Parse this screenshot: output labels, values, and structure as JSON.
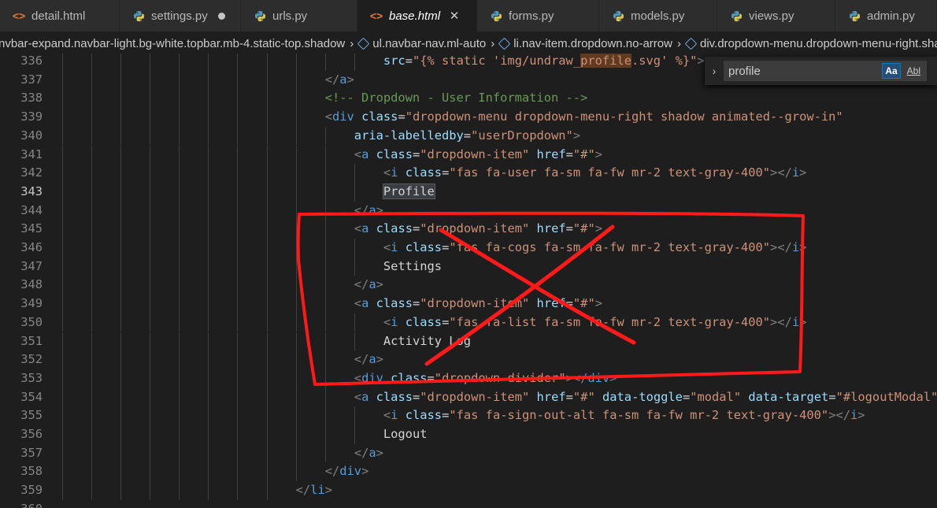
{
  "tabs": [
    {
      "label": "detail.html",
      "icon": "html-icon",
      "active": false,
      "trailing": ""
    },
    {
      "label": "settings.py",
      "icon": "python-icon",
      "active": false,
      "trailing": "modified-dot"
    },
    {
      "label": "urls.py",
      "icon": "python-icon",
      "active": false,
      "trailing": ""
    },
    {
      "label": "base.html",
      "icon": "html-icon",
      "active": true,
      "trailing": "close"
    },
    {
      "label": "forms.py",
      "icon": "python-icon",
      "active": false,
      "trailing": ""
    },
    {
      "label": "models.py",
      "icon": "python-icon",
      "active": false,
      "trailing": ""
    },
    {
      "label": "views.py",
      "icon": "python-icon",
      "active": false,
      "trailing": ""
    },
    {
      "label": "admin.py",
      "icon": "python-icon",
      "active": false,
      "trailing": ""
    }
  ],
  "breadcrumbs": [
    {
      "label": "nvbar-expand.navbar-light.bg-white.topbar.mb-4.static-top.shadow",
      "icon": ""
    },
    {
      "label": "ul.navbar-nav.ml-auto",
      "icon": "element-icon"
    },
    {
      "label": "li.nav-item.dropdown.no-arrow",
      "icon": "element-icon"
    },
    {
      "label": "div.dropdown-menu.dropdown-menu-right.shadow.animated--grow-in",
      "icon": "element-icon"
    }
  ],
  "find_widget": {
    "value": "profile",
    "match_case_label": "Aa",
    "whole_word_label": "Abl"
  },
  "editor": {
    "current_line": "343",
    "lines": [
      {
        "num": "336",
        "indent": 11,
        "tokens": [
          [
            "attr",
            "src"
          ],
          [
            "txt",
            "="
          ],
          [
            "str",
            "\"{% static 'img/undraw_"
          ],
          [
            "strfind",
            "profile"
          ],
          [
            "str",
            ".svg' %}\""
          ],
          [
            "br",
            ">"
          ]
        ]
      },
      {
        "num": "337",
        "indent": 9,
        "tokens": [
          [
            "br",
            "</"
          ],
          [
            "tag",
            "a"
          ],
          [
            "br",
            ">"
          ]
        ]
      },
      {
        "num": "338",
        "indent": 9,
        "tokens": [
          [
            "com",
            "<!-- Dropdown - User Information -->"
          ]
        ]
      },
      {
        "num": "339",
        "indent": 9,
        "tokens": [
          [
            "br",
            "<"
          ],
          [
            "tag",
            "div"
          ],
          [
            "txt",
            " "
          ],
          [
            "attr",
            "class"
          ],
          [
            "txt",
            "="
          ],
          [
            "str",
            "\"dropdown-menu dropdown-menu-right shadow animated--grow-in\""
          ]
        ]
      },
      {
        "num": "340",
        "indent": 10,
        "tokens": [
          [
            "attr",
            "aria-labelledby"
          ],
          [
            "txt",
            "="
          ],
          [
            "str",
            "\"userDropdown\""
          ],
          [
            "br",
            ">"
          ]
        ]
      },
      {
        "num": "341",
        "indent": 10,
        "tokens": [
          [
            "br",
            "<"
          ],
          [
            "tag",
            "a"
          ],
          [
            "txt",
            " "
          ],
          [
            "attr",
            "class"
          ],
          [
            "txt",
            "="
          ],
          [
            "str",
            "\"dropdown-item\""
          ],
          [
            "txt",
            " "
          ],
          [
            "attr",
            "href"
          ],
          [
            "txt",
            "="
          ],
          [
            "str",
            "\"#\""
          ],
          [
            "br",
            ">"
          ]
        ]
      },
      {
        "num": "342",
        "indent": 11,
        "tokens": [
          [
            "br",
            "<"
          ],
          [
            "tag",
            "i"
          ],
          [
            "txt",
            " "
          ],
          [
            "attr",
            "class"
          ],
          [
            "txt",
            "="
          ],
          [
            "str",
            "\"fas fa-user fa-sm fa-fw mr-2 text-gray-400\""
          ],
          [
            "br",
            "></"
          ],
          [
            "tag",
            "i"
          ],
          [
            "br",
            ">"
          ]
        ]
      },
      {
        "num": "343",
        "indent": 11,
        "tokens": [
          [
            "hl",
            "Profile"
          ]
        ]
      },
      {
        "num": "344",
        "indent": 10,
        "tokens": [
          [
            "br",
            "</"
          ],
          [
            "tag",
            "a"
          ],
          [
            "br",
            ">"
          ]
        ]
      },
      {
        "num": "345",
        "indent": 10,
        "tokens": [
          [
            "br",
            "<"
          ],
          [
            "tag",
            "a"
          ],
          [
            "txt",
            " "
          ],
          [
            "attr",
            "class"
          ],
          [
            "txt",
            "="
          ],
          [
            "str",
            "\"dropdown-item\""
          ],
          [
            "txt",
            " "
          ],
          [
            "attr",
            "href"
          ],
          [
            "txt",
            "="
          ],
          [
            "str",
            "\"#\""
          ],
          [
            "br",
            ">"
          ]
        ]
      },
      {
        "num": "346",
        "indent": 11,
        "tokens": [
          [
            "br",
            "<"
          ],
          [
            "tag",
            "i"
          ],
          [
            "txt",
            " "
          ],
          [
            "attr",
            "class"
          ],
          [
            "txt",
            "="
          ],
          [
            "str",
            "\"fas fa-cogs fa-sm fa-fw mr-2 text-gray-400\""
          ],
          [
            "br",
            "></"
          ],
          [
            "tag",
            "i"
          ],
          [
            "br",
            ">"
          ]
        ]
      },
      {
        "num": "347",
        "indent": 11,
        "tokens": [
          [
            "txt",
            "Settings"
          ]
        ]
      },
      {
        "num": "348",
        "indent": 10,
        "tokens": [
          [
            "br",
            "</"
          ],
          [
            "tag",
            "a"
          ],
          [
            "br",
            ">"
          ]
        ]
      },
      {
        "num": "349",
        "indent": 10,
        "tokens": [
          [
            "br",
            "<"
          ],
          [
            "tag",
            "a"
          ],
          [
            "txt",
            " "
          ],
          [
            "attr",
            "class"
          ],
          [
            "txt",
            "="
          ],
          [
            "str",
            "\"dropdown-item\""
          ],
          [
            "txt",
            " "
          ],
          [
            "attr",
            "href"
          ],
          [
            "txt",
            "="
          ],
          [
            "str",
            "\"#\""
          ],
          [
            "br",
            ">"
          ]
        ]
      },
      {
        "num": "350",
        "indent": 11,
        "tokens": [
          [
            "br",
            "<"
          ],
          [
            "tag",
            "i"
          ],
          [
            "txt",
            " "
          ],
          [
            "attr",
            "class"
          ],
          [
            "txt",
            "="
          ],
          [
            "str",
            "\"fas fa-list fa-sm fa-fw mr-2 text-gray-400\""
          ],
          [
            "br",
            "></"
          ],
          [
            "tag",
            "i"
          ],
          [
            "br",
            ">"
          ]
        ]
      },
      {
        "num": "351",
        "indent": 11,
        "tokens": [
          [
            "txt",
            "Activity Log"
          ]
        ]
      },
      {
        "num": "352",
        "indent": 10,
        "tokens": [
          [
            "br",
            "</"
          ],
          [
            "tag",
            "a"
          ],
          [
            "br",
            ">"
          ]
        ]
      },
      {
        "num": "353",
        "indent": 10,
        "tokens": [
          [
            "br",
            "<"
          ],
          [
            "tag",
            "div"
          ],
          [
            "txt",
            " "
          ],
          [
            "attr",
            "class"
          ],
          [
            "txt",
            "="
          ],
          [
            "str",
            "\"dropdown-divider\""
          ],
          [
            "br",
            "></"
          ],
          [
            "tag",
            "div"
          ],
          [
            "br",
            ">"
          ]
        ]
      },
      {
        "num": "354",
        "indent": 10,
        "tokens": [
          [
            "br",
            "<"
          ],
          [
            "tag",
            "a"
          ],
          [
            "txt",
            " "
          ],
          [
            "attr",
            "class"
          ],
          [
            "txt",
            "="
          ],
          [
            "str",
            "\"dropdown-item\""
          ],
          [
            "txt",
            " "
          ],
          [
            "attr",
            "href"
          ],
          [
            "txt",
            "="
          ],
          [
            "str",
            "\"#\""
          ],
          [
            "txt",
            " "
          ],
          [
            "attr",
            "data-toggle"
          ],
          [
            "txt",
            "="
          ],
          [
            "str",
            "\"modal\""
          ],
          [
            "txt",
            " "
          ],
          [
            "attr",
            "data-target"
          ],
          [
            "txt",
            "="
          ],
          [
            "str",
            "\"#logoutModal\""
          ],
          [
            "br",
            ">"
          ]
        ]
      },
      {
        "num": "355",
        "indent": 11,
        "tokens": [
          [
            "br",
            "<"
          ],
          [
            "tag",
            "i"
          ],
          [
            "txt",
            " "
          ],
          [
            "attr",
            "class"
          ],
          [
            "txt",
            "="
          ],
          [
            "str",
            "\"fas fa-sign-out-alt fa-sm fa-fw mr-2 text-gray-400\""
          ],
          [
            "br",
            "></"
          ],
          [
            "tag",
            "i"
          ],
          [
            "br",
            ">"
          ]
        ]
      },
      {
        "num": "356",
        "indent": 11,
        "tokens": [
          [
            "txt",
            "Logout"
          ]
        ]
      },
      {
        "num": "357",
        "indent": 10,
        "tokens": [
          [
            "br",
            "</"
          ],
          [
            "tag",
            "a"
          ],
          [
            "br",
            ">"
          ]
        ]
      },
      {
        "num": "358",
        "indent": 9,
        "tokens": [
          [
            "br",
            "</"
          ],
          [
            "tag",
            "div"
          ],
          [
            "br",
            ">"
          ]
        ]
      },
      {
        "num": "359",
        "indent": 8,
        "tokens": [
          [
            "br",
            "</"
          ],
          [
            "tag",
            "li"
          ],
          [
            "br",
            ">"
          ]
        ]
      },
      {
        "num": "360",
        "indent": 0,
        "tokens": []
      }
    ]
  },
  "annotation": {
    "color": "#ff1a1a"
  },
  "colors": {
    "background": "#1e1e1e",
    "tag": "#569cd6",
    "attr": "#9cdcfe",
    "string": "#ce9178",
    "comment": "#6a9955"
  }
}
